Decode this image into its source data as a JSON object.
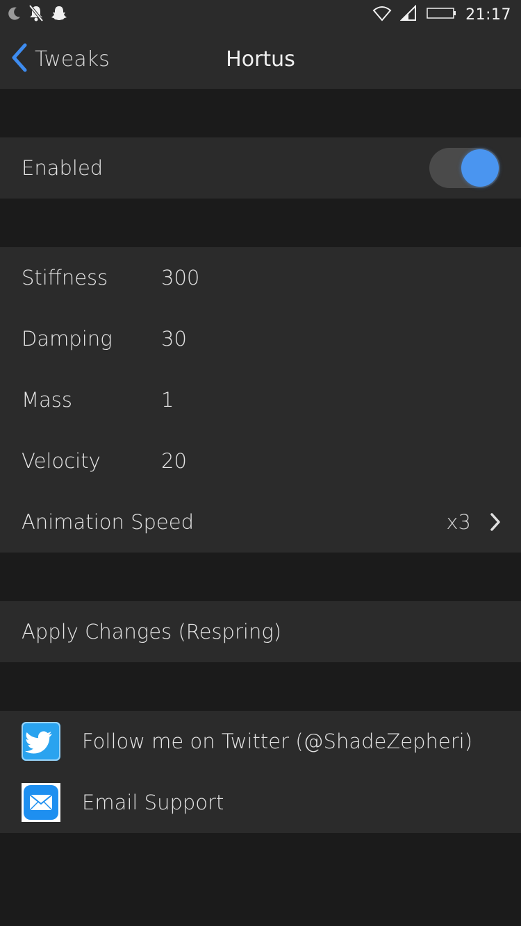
{
  "status_bar": {
    "time": "21:17",
    "icons": [
      "moon-icon",
      "bell-off-icon",
      "snapchat-icon",
      "wifi-icon",
      "signal-icon",
      "battery-icon"
    ]
  },
  "nav": {
    "back_label": "Tweaks",
    "title": "Hortus"
  },
  "enabled_group": {
    "label": "Enabled",
    "toggle_on": true
  },
  "spring_group": {
    "rows": [
      {
        "label": "Stiffness",
        "value": "300"
      },
      {
        "label": "Damping",
        "value": "30"
      },
      {
        "label": "Mass",
        "value": "1"
      },
      {
        "label": "Velocity",
        "value": "20"
      }
    ],
    "animation_speed": {
      "label": "Animation Speed",
      "value": "x3"
    }
  },
  "apply_group": {
    "label": "Apply Changes (Respring)"
  },
  "links_group": {
    "twitter": {
      "label": "Follow me on Twitter (@ShadeZepheri)",
      "icon": "twitter-icon"
    },
    "email": {
      "label": "Email Support",
      "icon": "mail-icon"
    }
  },
  "colors": {
    "accent": "#4a95f0",
    "background": "#1b1b1b",
    "cell": "#2b2b2b",
    "text": "#e4e4e4"
  }
}
